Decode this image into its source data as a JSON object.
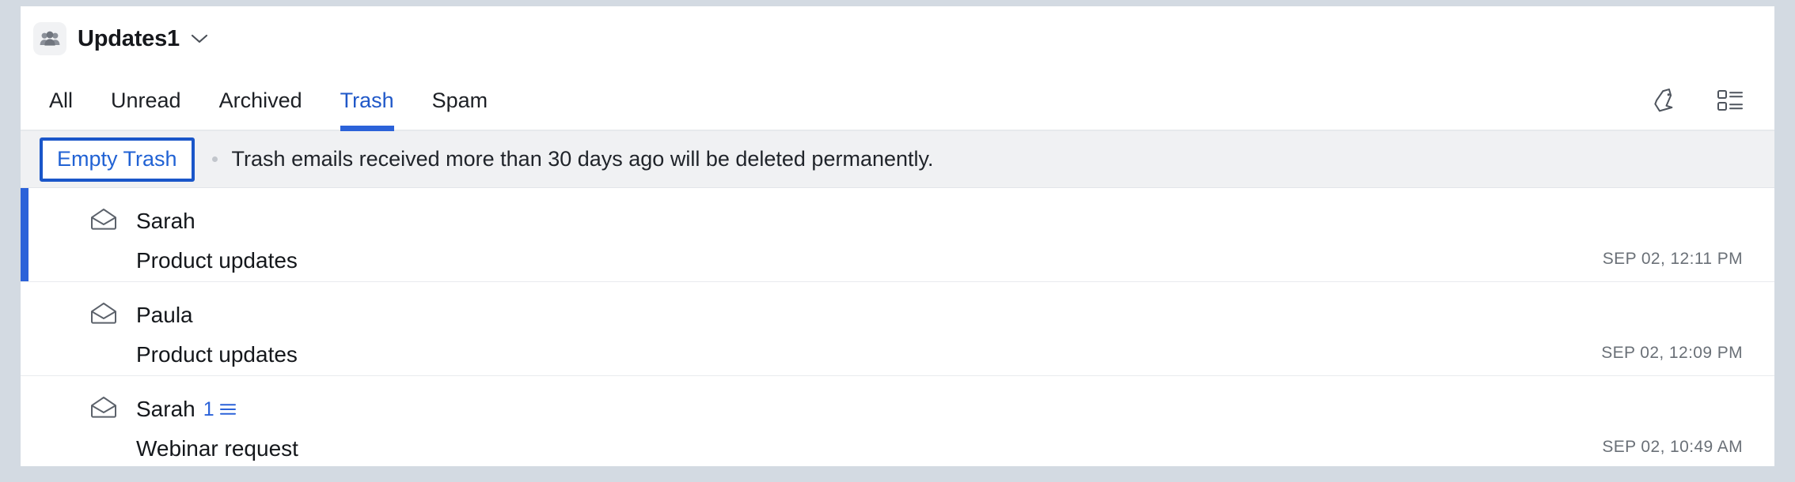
{
  "theme": {
    "accent": "#2b62d9",
    "link": "#2162d4",
    "page_bg": "#d3dae2",
    "panel_bg": "#ffffff",
    "banner_bg": "#f0f1f3",
    "text": "#14171b",
    "muted": "#6a7077"
  },
  "header": {
    "folder_icon": "group-people-icon",
    "title": "Updates1",
    "chevron_icon": "chevron-down-icon"
  },
  "tabs": [
    {
      "label": "All",
      "active": false
    },
    {
      "label": "Unread",
      "active": false
    },
    {
      "label": "Archived",
      "active": false
    },
    {
      "label": "Trash",
      "active": true
    },
    {
      "label": "Spam",
      "active": false
    }
  ],
  "toolbar": {
    "icons": [
      {
        "name": "tag-icon"
      },
      {
        "name": "list-view-icon"
      }
    ]
  },
  "banner": {
    "button_label": "Empty Trash",
    "separator": "dot-separator",
    "message": "Trash emails received more than 30 days ago will be deleted permanently."
  },
  "mail_list": [
    {
      "icon": "open-envelope-icon",
      "sender": "Sarah",
      "thread_count": "",
      "subject": "Product updates",
      "time": "SEP 02, 12:11 PM",
      "selected": true
    },
    {
      "icon": "open-envelope-icon",
      "sender": "Paula",
      "thread_count": "",
      "subject": "Product updates",
      "time": "SEP 02, 12:09 PM",
      "selected": false
    },
    {
      "icon": "open-envelope-icon",
      "sender": "Sarah",
      "thread_count": "1",
      "subject": "Webinar request",
      "time": "SEP 02, 10:49 AM",
      "selected": false
    }
  ]
}
